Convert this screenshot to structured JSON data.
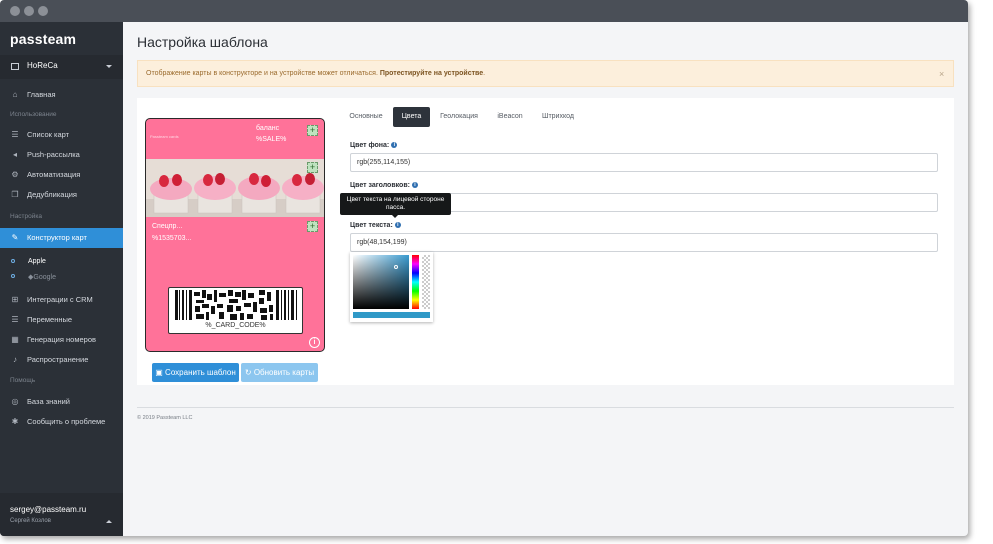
{
  "sidebar": {
    "logo": "passteam",
    "org": "HoReCa",
    "items": [
      {
        "label": "Главная",
        "icon": "home-icon"
      },
      {
        "label": "Список карт",
        "icon": "list-icon"
      },
      {
        "label": "Push-рассылка",
        "icon": "megaphone-icon"
      },
      {
        "label": "Автоматизация",
        "icon": "gear-icon"
      },
      {
        "label": "Дедубликация",
        "icon": "copy-icon"
      },
      {
        "label": "Конструктор карт",
        "icon": "brush-icon"
      },
      {
        "label": "Интеграции с CRM",
        "icon": "sitemap-icon"
      },
      {
        "label": "Переменные",
        "icon": "list-icon"
      },
      {
        "label": "Генерация номеров",
        "icon": "grid-icon"
      },
      {
        "label": "Распространение",
        "icon": "bell-icon"
      },
      {
        "label": "База знаний",
        "icon": "lifebuoy-icon"
      },
      {
        "label": "Сообщить о проблеме",
        "icon": "bug-icon"
      }
    ],
    "sections": [
      "Использование",
      "Настройка",
      "Помощь"
    ],
    "subitems": [
      {
        "label": "Apple",
        "icon": "apple-icon"
      },
      {
        "label": "Google",
        "icon": "google-icon"
      }
    ],
    "user": {
      "email": "sergey@passteam.ru",
      "name": "Сергей Козлов"
    }
  },
  "page": {
    "title": "Настройка шаблона",
    "alert": {
      "text": "Отображение карты в конструкторе и на устройстве может отличаться.",
      "link": "Протестируйте на устройстве",
      "close": "×"
    }
  },
  "card": {
    "brand": "Passteam cards",
    "balance_label": "баланс",
    "balance_value": "%SALE%",
    "field_label": "Спецпр...",
    "field_value": "%1535703...",
    "barcode_text": "%_CARD_CODE%",
    "colors": {
      "background": "#ff7299"
    }
  },
  "buttons": {
    "save": "Сохранить шаблон",
    "refresh": "Обновить карты"
  },
  "tabs": [
    {
      "label": "Основные",
      "active": false
    },
    {
      "label": "Цвета",
      "active": true
    },
    {
      "label": "Геолокация",
      "active": false
    },
    {
      "label": "iBeacon",
      "active": false
    },
    {
      "label": "Штрихкод",
      "active": false
    }
  ],
  "fields": {
    "bg": {
      "label": "Цвет фона:",
      "value": "rgb(255,114,155)"
    },
    "header": {
      "label": "Цвет заголовков:",
      "value": ""
    },
    "text": {
      "label": "Цвет текста:",
      "value": "rgb(48,154,199)"
    }
  },
  "tooltip": "Цвет текста на лицевой стороне пасса.",
  "footer": "© 2019 Passteam LLC"
}
